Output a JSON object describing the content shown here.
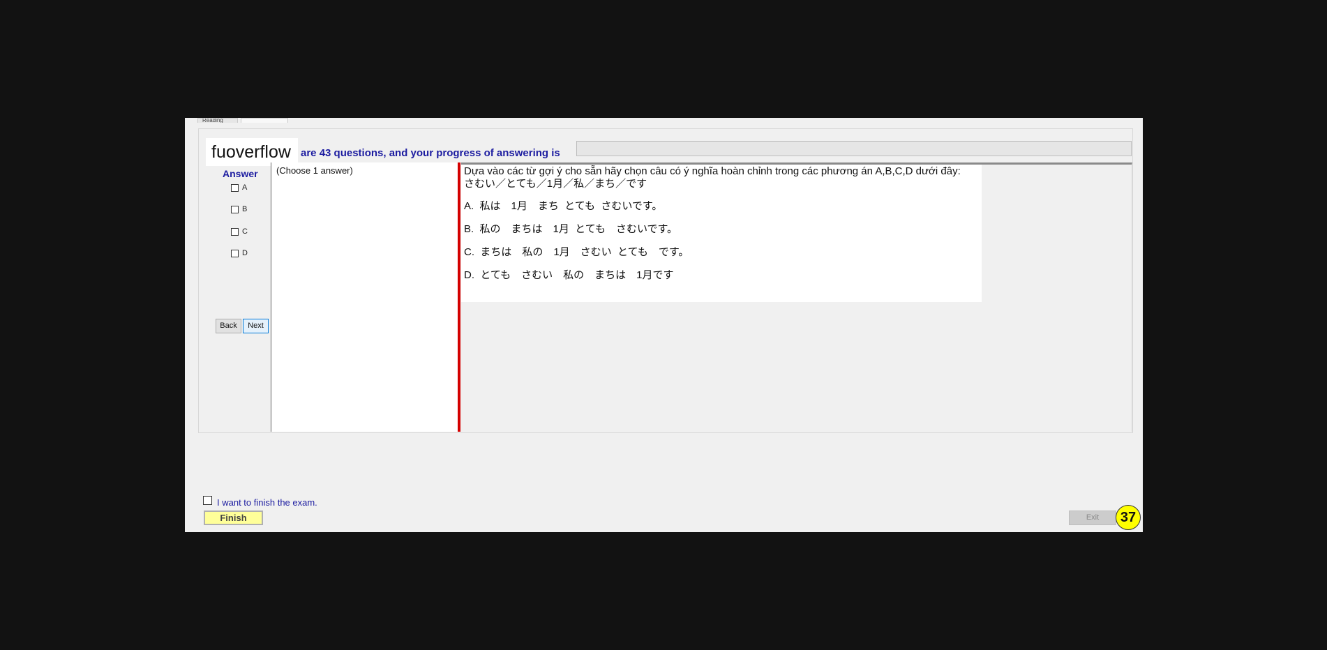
{
  "tabs": [
    "Reading",
    ""
  ],
  "brand": "fuoverflow",
  "header": {
    "progress_text": "are 43 questions, and your progress of answering is",
    "progress_value": 0
  },
  "answer_panel": {
    "title": "Answer",
    "options": [
      "A",
      "B",
      "C",
      "D"
    ]
  },
  "nav": {
    "back_label": "Back",
    "next_label": "Next"
  },
  "choose_panel": {
    "instruction": "(Choose 1 answer)"
  },
  "question": {
    "prompt": "Dựa vào các từ gợi ý cho sẵn hãy chọn câu có ý nghĩa hoàn chỉnh trong các phương án A,B,C,D dưới đây:",
    "hint": "さむい／とても／1月／私／まち／です",
    "choices": [
      "A.  私は　1月　まち  とても  さむいです。",
      "B.  私の　まちは　1月  とても　さむいです。",
      "C.  まちは　私の　1月　さむい  とても　です。",
      "D.  とても　さむい　私の　まちは　1月です"
    ]
  },
  "footer": {
    "finish_checkbox_label": "I want to finish the exam.",
    "finish_label": "Finish",
    "exit_label": "Exit",
    "timer": "37"
  }
}
